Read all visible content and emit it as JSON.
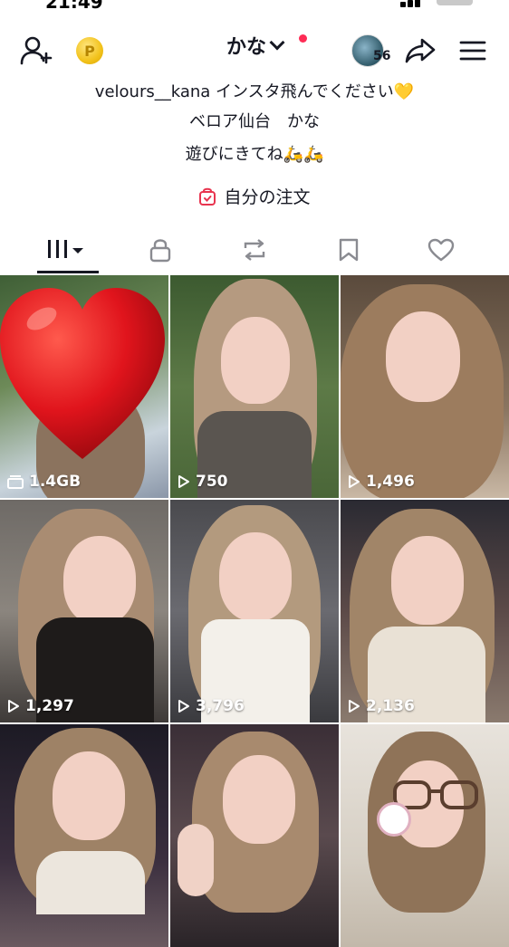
{
  "status_bar": {
    "time": "21:49"
  },
  "header": {
    "username": "かな",
    "avatar_badge": "56",
    "icons": [
      "add-friend-icon",
      "coin-icon",
      "share-icon",
      "menu-icon"
    ]
  },
  "bio": {
    "line1": "velours__kana インスタ飛んでください💛",
    "line2": "ベロア仙台　かな",
    "line3": "遊びにきてね🛵🛵"
  },
  "orders": {
    "label": "自分の注文"
  },
  "tabs": [
    "videos",
    "private",
    "reposts",
    "favorites",
    "liked"
  ],
  "grid": {
    "items": [
      {
        "kind": "storage",
        "label": "1.4GB"
      },
      {
        "kind": "video",
        "label": "750"
      },
      {
        "kind": "video",
        "label": "1,496"
      },
      {
        "kind": "video",
        "label": "1,297"
      },
      {
        "kind": "video",
        "label": "3,796"
      },
      {
        "kind": "video",
        "label": "2,136"
      },
      {
        "kind": "video",
        "label": ""
      },
      {
        "kind": "video",
        "label": ""
      },
      {
        "kind": "video",
        "label": ""
      }
    ]
  },
  "colors": {
    "accent": "#fe2c55",
    "text": "#161823",
    "coin": "#f2c21b"
  }
}
